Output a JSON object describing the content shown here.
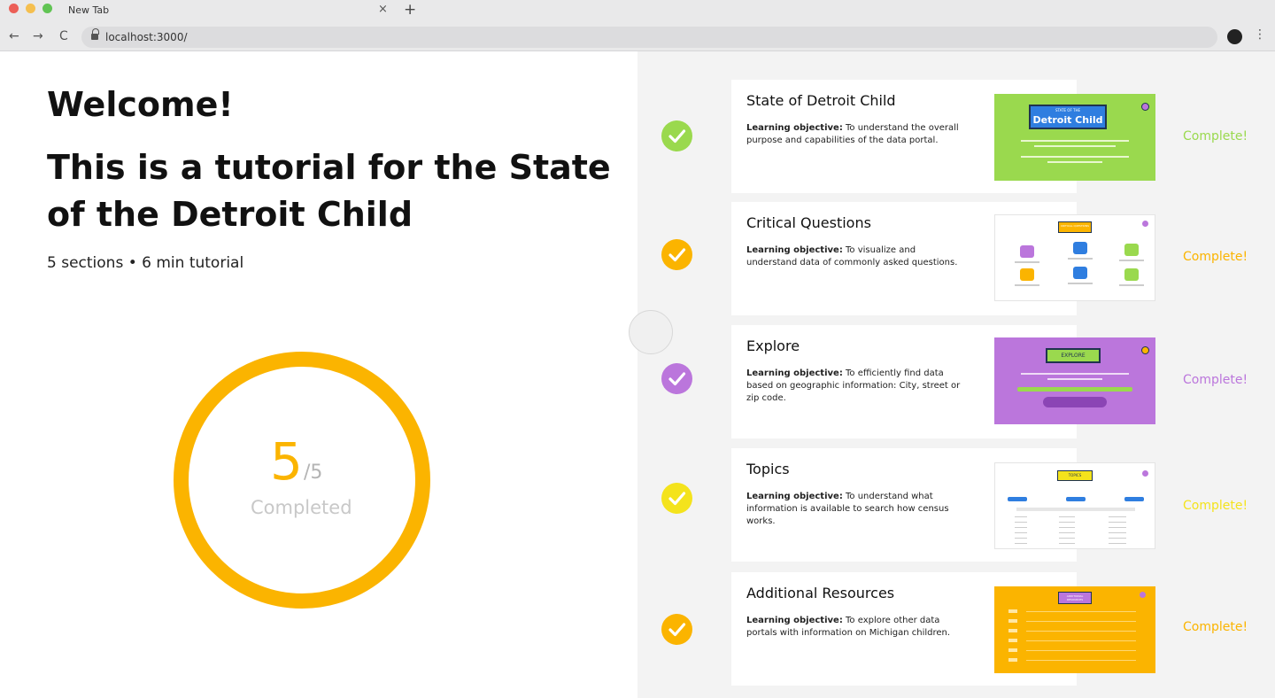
{
  "browser": {
    "tab_title": "New Tab",
    "tab_close": "×",
    "new_tab": "+",
    "url": "localhost:3000/",
    "nav_back": "←",
    "nav_forward": "→",
    "nav_reload": "C",
    "menu": "⋮"
  },
  "intro": {
    "welcome": "Welcome!",
    "subtitle": "This is a tutorial for the State of the Detroit Child",
    "meta": "5 sections • 6 min tutorial"
  },
  "progress": {
    "completed": 5,
    "total_label": "/5",
    "completed_label": "Completed",
    "fraction": 1.0
  },
  "sections": [
    {
      "title": "State of Detroit Child",
      "objective_label": "Learning objective:",
      "objective": "To understand the overall purpose and capabilities of the data portal.",
      "status": "Complete!",
      "color": "#9ad94e",
      "thumb_text": "Detroit Child",
      "thumb_small": "STATE OF THE"
    },
    {
      "title": "Critical Questions",
      "objective_label": "Learning objective:",
      "objective": "To visualize and understand data of commonly asked questions.",
      "status": "Complete!",
      "color": "#fbb400",
      "thumb_text": "CRITICAL QUESTIONS"
    },
    {
      "title": "Explore",
      "objective_label": "Learning objective:",
      "objective": "To efficiently find data based on geographic information: City, street or zip code.",
      "status": "Complete!",
      "color": "#bb76dc",
      "thumb_text": "EXPLORE"
    },
    {
      "title": "Topics",
      "objective_label": "Learning objective:",
      "objective": "To understand what information is available to search how census works.",
      "status": "Complete!",
      "color": "#f4e31c",
      "thumb_text": "TOPICS"
    },
    {
      "title": "Additional Resources",
      "objective_label": "Learning objective:",
      "objective": "To explore other data portals with information on Michigan children.",
      "status": "Complete!",
      "color": "#fbb400",
      "thumb_text": "ADDITIONAL RESOURCES"
    }
  ],
  "icons": {
    "check": "check-icon",
    "lock": "lock-icon"
  }
}
